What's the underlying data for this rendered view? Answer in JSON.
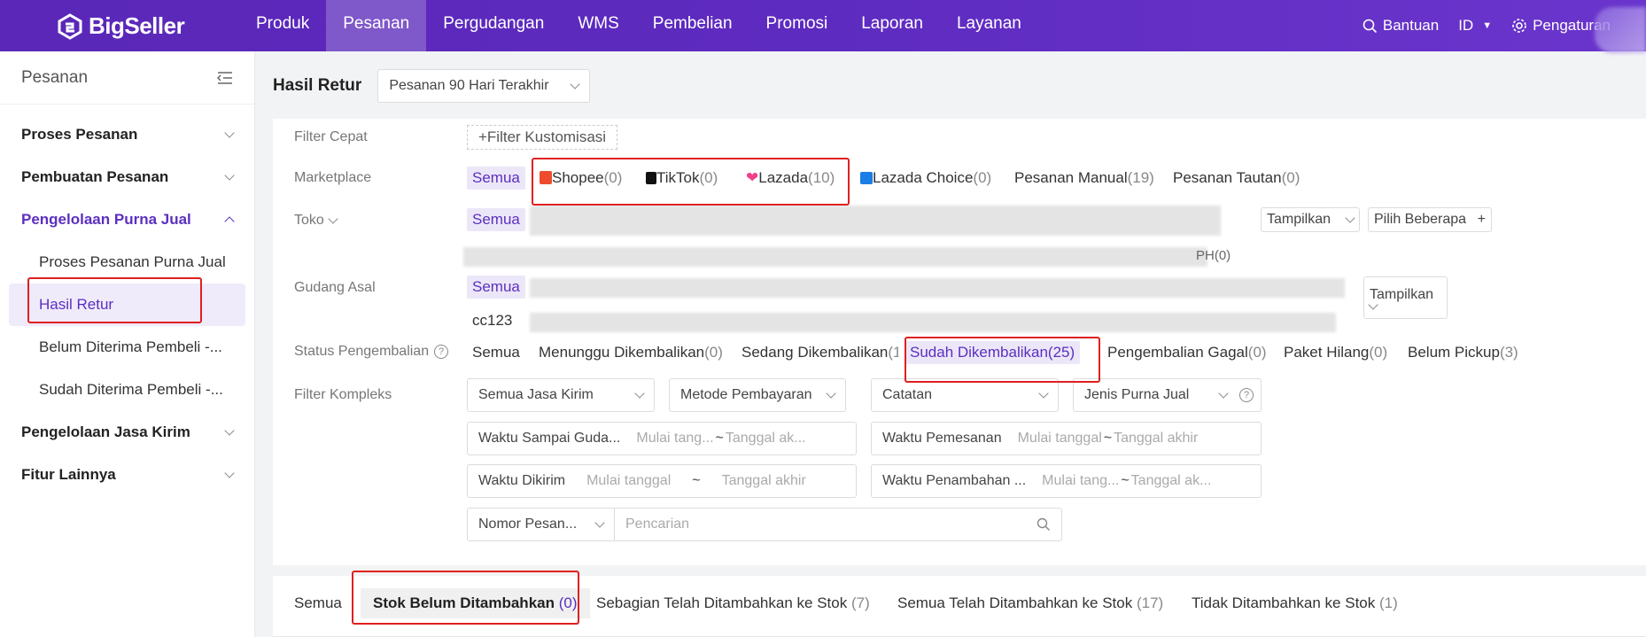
{
  "app": {
    "logo_text": "BigSeller"
  },
  "nav": [
    {
      "label": "Produk"
    },
    {
      "label": "Pesanan"
    },
    {
      "label": "Pergudangan"
    },
    {
      "label": "WMS"
    },
    {
      "label": "Pembelian"
    },
    {
      "label": "Promosi"
    },
    {
      "label": "Laporan"
    },
    {
      "label": "Layanan"
    }
  ],
  "topright": {
    "help": "Bantuan",
    "lang": "ID",
    "settings": "Pengaturan"
  },
  "sidebar": {
    "title": "Pesanan",
    "sections": [
      {
        "label": "Proses Pesanan"
      },
      {
        "label": "Pembuatan Pesanan"
      },
      {
        "label": "Pengelolaan Purna Jual"
      },
      {
        "label": "Pengelolaan Jasa Kirim"
      },
      {
        "label": "Fitur Lainnya"
      }
    ],
    "subitems": [
      {
        "label": "Proses Pesanan Purna Jual"
      },
      {
        "label": "Hasil Retur"
      },
      {
        "label": "Belum Diterima Pembeli -..."
      },
      {
        "label": "Sudah Diterima Pembeli -..."
      }
    ]
  },
  "page": {
    "title": "Hasil Retur",
    "period": "Pesanan 90 Hari Terakhir"
  },
  "filters": {
    "quick_label": "Filter Cepat",
    "custom_filter": "+Filter Kustomisasi",
    "marketplace_label": "Marketplace",
    "marketplace": [
      {
        "name": "Semua",
        "count": ""
      },
      {
        "name": "Shopee",
        "count": "(0)"
      },
      {
        "name": "TikTok",
        "count": "(0)"
      },
      {
        "name": "Lazada",
        "count": "(10)"
      },
      {
        "name": "Lazada Choice",
        "count": "(0)"
      },
      {
        "name": "Pesanan Manual",
        "count": "(19)"
      },
      {
        "name": "Pesanan Tautan",
        "count": "(0)"
      }
    ],
    "toko_label": "Toko",
    "toko_all": "Semua",
    "toko_partial": "PH(0)",
    "tampilkan": "Tampilkan",
    "pilih_beberapa": "Pilih Beberapa",
    "gudang_label": "Gudang Asal",
    "gudang_all": "Semua",
    "gudang_item": "cc123",
    "status_label": "Status Pengembalian",
    "status": [
      {
        "name": "Semua",
        "count": ""
      },
      {
        "name": "Menunggu Dikembalikan",
        "count": "(0)"
      },
      {
        "name": "Sedang Dikembalikan",
        "count": "(1)"
      },
      {
        "name": "Sudah Dikembalikan",
        "count": "(25)"
      },
      {
        "name": "Pengembalian Gagal",
        "count": "(0)"
      },
      {
        "name": "Paket Hilang",
        "count": "(0)"
      },
      {
        "name": "Belum Pickup",
        "count": "(3)"
      }
    ],
    "complex_label": "Filter Kompleks",
    "selects": [
      "Semua Jasa Kirim",
      "Metode Pembayaran",
      "Catatan",
      "Jenis Purna Jual"
    ],
    "dates": [
      {
        "label": "Waktu Sampai Guda...",
        "start": "Mulai tang...",
        "sep": "~",
        "end": "Tanggal ak..."
      },
      {
        "label": "Waktu Pemesanan",
        "start": "Mulai tanggal",
        "sep": "~",
        "end": "Tanggal akhir"
      },
      {
        "label": "Waktu Dikirim",
        "start": "Mulai tanggal",
        "sep": "~",
        "end": "Tanggal akhir"
      },
      {
        "label": "Waktu Penambahan ...",
        "start": "Mulai tang...",
        "sep": "~",
        "end": "Tanggal ak..."
      }
    ],
    "search_type": "Nomor Pesan...",
    "search_placeholder": "Pencarian"
  },
  "tabs": [
    {
      "label": "Semua",
      "count": ""
    },
    {
      "label": "Stok Belum Ditambahkan",
      "count": "(0)"
    },
    {
      "label": "Sebagian Telah Ditambahkan ke Stok",
      "count": "(7)"
    },
    {
      "label": "Semua Telah Ditambahkan ke Stok",
      "count": "(17)"
    },
    {
      "label": "Tidak Ditambahkan ke Stok",
      "count": "(1)"
    }
  ],
  "colors": {
    "brand": "#5b2fc0",
    "highlight": "#e02020",
    "shopee": "#ee4d2d",
    "lazada": "#f0408a",
    "lazada_choice": "#1a7ee6"
  }
}
